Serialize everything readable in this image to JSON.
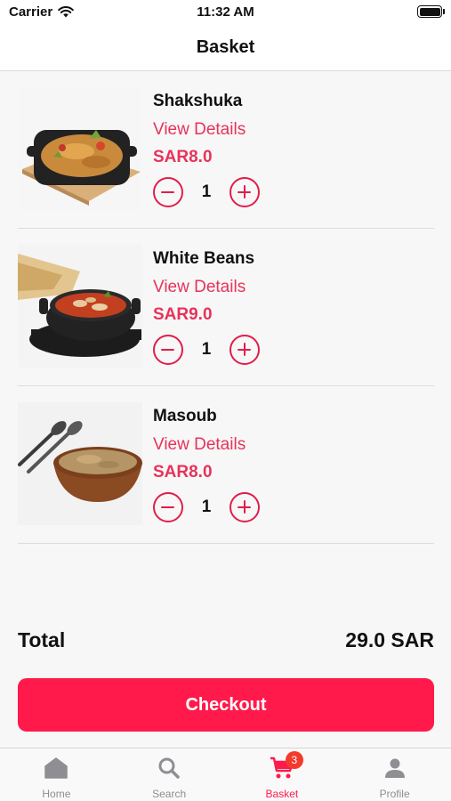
{
  "status_bar": {
    "carrier": "Carrier",
    "time": "11:32 AM"
  },
  "nav": {
    "title": "Basket"
  },
  "items": [
    {
      "name": "Shakshuka",
      "details_label": "View Details",
      "price": "SAR8.0",
      "quantity": "1",
      "image": "shakshuka-skillet"
    },
    {
      "name": "White Beans",
      "details_label": "View Details",
      "price": "SAR9.0",
      "quantity": "1",
      "image": "white-beans-pot"
    },
    {
      "name": "Masoub",
      "details_label": "View Details",
      "price": "SAR8.0",
      "quantity": "1",
      "image": "masoub-bowl"
    }
  ],
  "summary": {
    "total_label": "Total",
    "total_value": "29.0 SAR"
  },
  "checkout": {
    "label": "Checkout"
  },
  "tabs": [
    {
      "label": "Home",
      "icon": "home-icon",
      "active": false
    },
    {
      "label": "Search",
      "icon": "search-icon",
      "active": false
    },
    {
      "label": "Basket",
      "icon": "cart-icon",
      "active": true,
      "badge": "3"
    },
    {
      "label": "Profile",
      "icon": "person-icon",
      "active": false
    }
  ],
  "colors": {
    "accent": "#ff1a4b",
    "link": "#e8325a",
    "badge": "#f33a2c",
    "inactive_tab": "#8e8e93"
  }
}
